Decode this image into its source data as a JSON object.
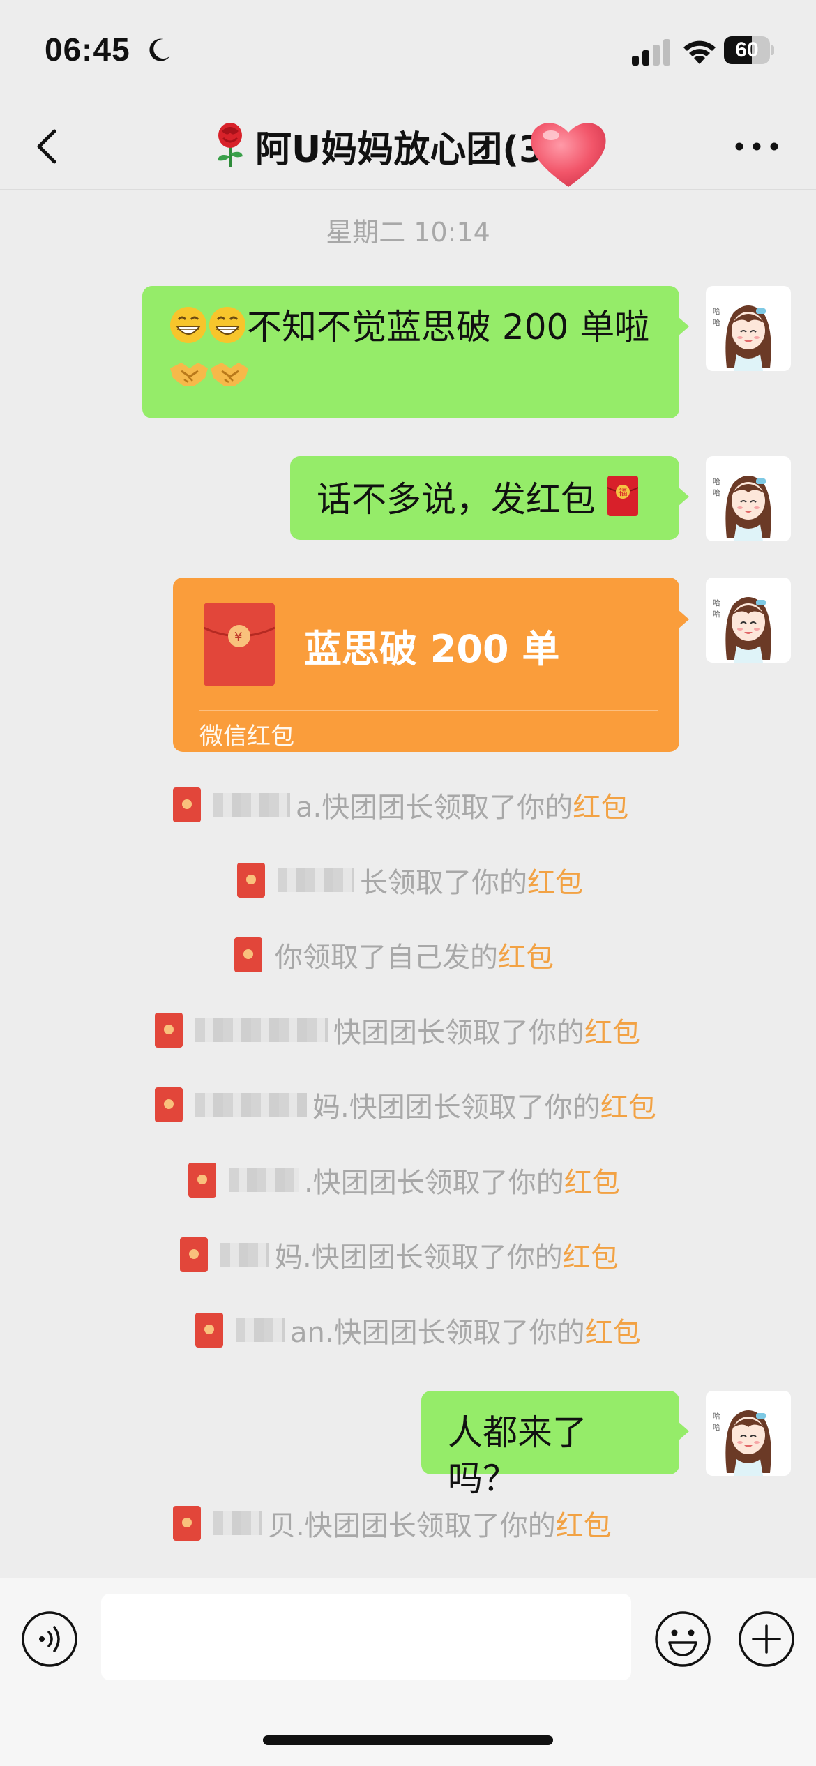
{
  "status_bar": {
    "time": "06:45",
    "battery": "60",
    "battery_level": 0.6
  },
  "nav": {
    "title": "阿U妈妈放心团(3"
  },
  "chat": {
    "timestamp": "星期二 10:14",
    "messages": [
      {
        "text": "不知不觉蓝思破 200 单啦"
      },
      {
        "text": "话不多说，发红包"
      },
      {
        "text": "人都来了吗？"
      }
    ],
    "red_packet": {
      "title": "蓝思破 200 单",
      "footer": "微信红包"
    },
    "notices": [
      {
        "text": "a.快团团长领取了你的",
        "highlight": "红包"
      },
      {
        "text": "长领取了你的",
        "highlight": "红包"
      },
      {
        "text": "你领取了自己发的",
        "highlight": "红包"
      },
      {
        "text": "快团团长领取了你的",
        "highlight": "红包"
      },
      {
        "text": "妈.快团团长领取了你的",
        "highlight": "红包"
      },
      {
        "text": ".快团团长领取了你的",
        "highlight": "红包"
      },
      {
        "text": "妈.快团团长领取了你的",
        "highlight": "红包"
      },
      {
        "text": "an.快团团长领取了你的",
        "highlight": "红包"
      },
      {
        "text": "贝.快团团长领取了你的",
        "highlight": "红包"
      }
    ]
  },
  "input_bar": {
    "placeholder": ""
  },
  "colors": {
    "background": "#ededed",
    "bubble_green": "#95ec69",
    "red_packet_orange": "#fa9d3b",
    "red_packet_red": "#e2463a",
    "link_orange": "#f2a244",
    "gray_text": "#a8a8a8"
  },
  "icons": [
    "moon-icon",
    "signal-icon",
    "wifi-icon",
    "battery-icon",
    "back-chevron-icon",
    "rose-emoji-icon",
    "heart-sticker-icon",
    "more-dots-icon",
    "grin-emoji-icon",
    "handshake-emoji-icon",
    "fu-red-envelope-icon",
    "red-packet-icon",
    "voice-icon",
    "emoji-icon",
    "plus-icon"
  ]
}
